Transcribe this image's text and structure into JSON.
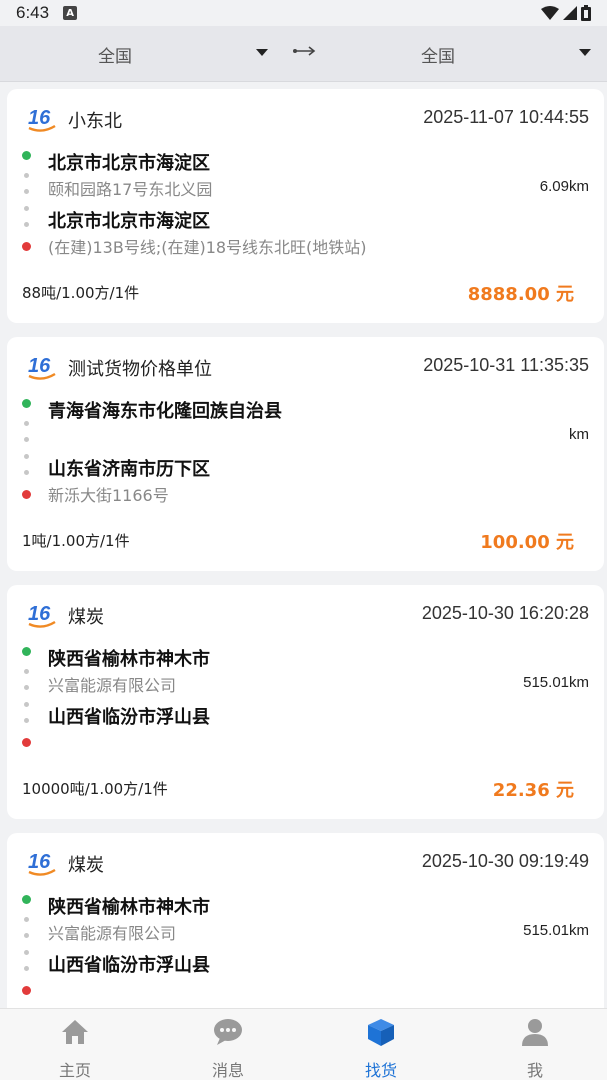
{
  "status_bar": {
    "time": "6:43",
    "indicator": "A"
  },
  "filter": {
    "from": "全国",
    "to": "全国"
  },
  "cards": [
    {
      "name": "小东北",
      "time": "2025-11-07 10:44:55",
      "origin_city": "北京市北京市海淀区",
      "origin_addr": "颐和园路17号东北义园",
      "distance": "6.09km",
      "dest_city": "北京市北京市海淀区",
      "dest_addr": "(在建)13B号线;(在建)18号线东北旺(地铁站)",
      "spec": "88吨/1.00方/1件",
      "price": "8888.00 元"
    },
    {
      "name": "测试货物价格单位",
      "time": "2025-10-31 11:35:35",
      "origin_city": "青海省海东市化隆回族自治县",
      "origin_addr": "",
      "distance": "km",
      "dest_city": "山东省济南市历下区",
      "dest_addr": "新泺大街1166号",
      "spec": "1吨/1.00方/1件",
      "price": "100.00 元"
    },
    {
      "name": "煤炭",
      "time": "2025-10-30 16:20:28",
      "origin_city": "陕西省榆林市神木市",
      "origin_addr": "兴富能源有限公司",
      "distance": "515.01km",
      "dest_city": "山西省临汾市浮山县",
      "dest_addr": "",
      "spec": "10000吨/1.00方/1件",
      "price": "22.36 元"
    },
    {
      "name": "煤炭",
      "time": "2025-10-30 09:19:49",
      "origin_city": "陕西省榆林市神木市",
      "origin_addr": "兴富能源有限公司",
      "distance": "515.01km",
      "dest_city": "山西省临汾市浮山县",
      "dest_addr": "",
      "spec": "",
      "price": ""
    }
  ],
  "tabs": [
    {
      "label": "主页",
      "icon": "home-icon"
    },
    {
      "label": "消息",
      "icon": "message-icon"
    },
    {
      "label": "找货",
      "icon": "cube-icon"
    },
    {
      "label": "我",
      "icon": "user-icon"
    }
  ],
  "colors": {
    "price": "#f07a1e",
    "active_tab": "#1e73d6",
    "origin_dot": "#31b45a",
    "dest_dot": "#e23b3b"
  }
}
